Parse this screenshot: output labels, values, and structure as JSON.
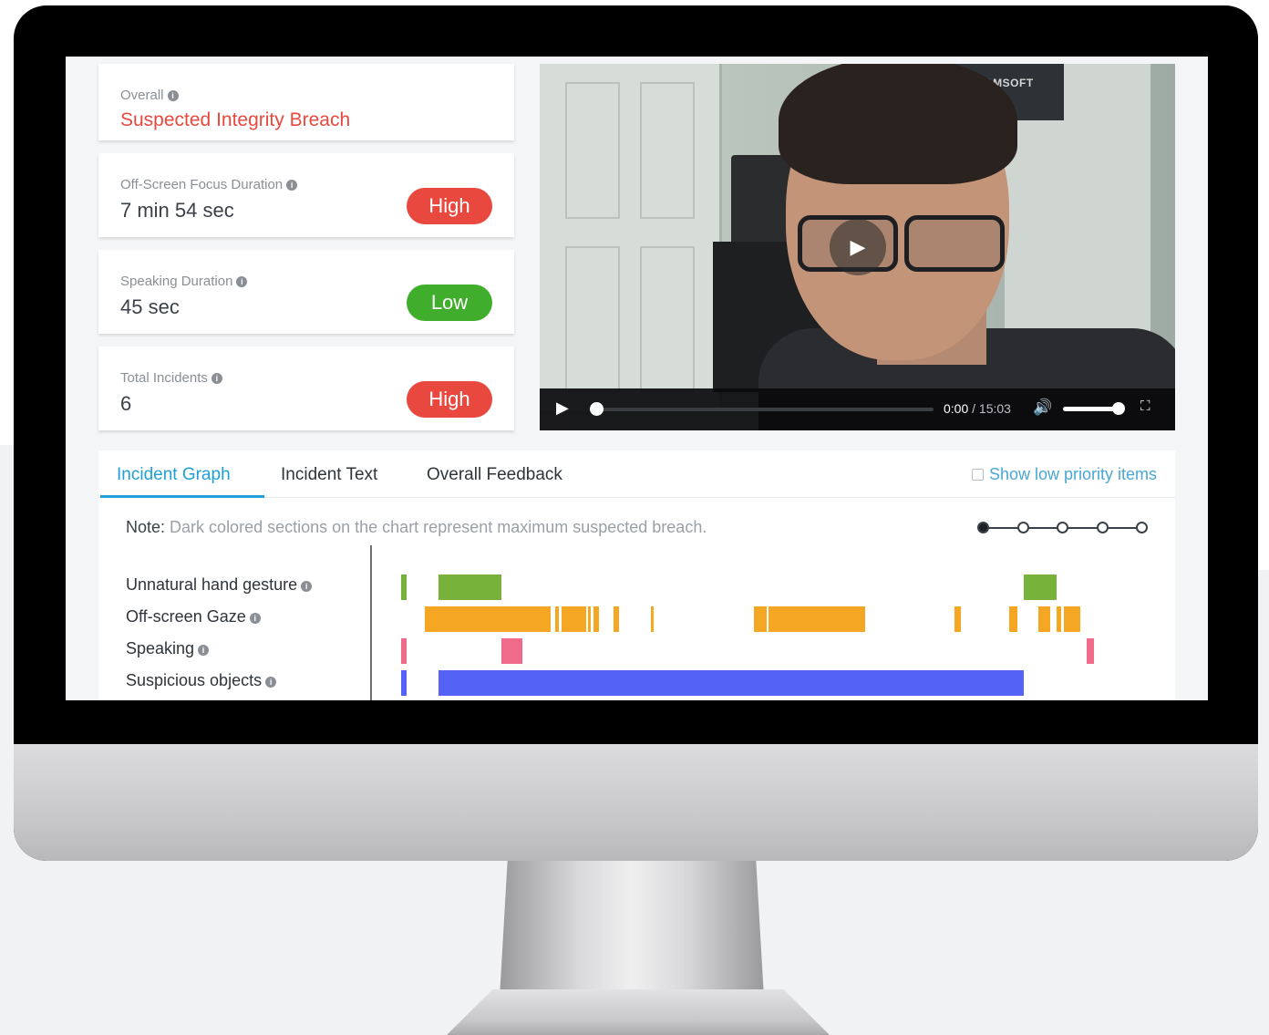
{
  "summary_cards": [
    {
      "label": "Overall",
      "value": "Suspected Integrity Breach",
      "badge": "",
      "value_color": "#e8483e"
    },
    {
      "label": "Off-Screen Focus Duration",
      "value": "7 min 54 sec",
      "badge": "High",
      "badge_color": "#e8483e"
    },
    {
      "label": "Speaking Duration",
      "value": "45 sec",
      "badge": "Low",
      "badge_color": "#40ad2c"
    },
    {
      "label": "Total Incidents",
      "value": "6",
      "badge": "High",
      "badge_color": "#e8483e"
    }
  ],
  "info_icon": "i",
  "video": {
    "poster_text": "EXAMSOFT",
    "current_time": "0:00",
    "separator": " / ",
    "duration": "15:03",
    "progress": 0.0,
    "volume": 1.0
  },
  "tabs": [
    {
      "label": "Incident Graph",
      "active": true
    },
    {
      "label": "Incident Text",
      "active": false
    },
    {
      "label": "Overall Feedback",
      "active": false
    }
  ],
  "low_priority_label": "Show low priority items",
  "note": {
    "prefix": "Note:",
    "text": "Dark colored sections on the chart represent maximum suspected breach."
  },
  "zoom_levels": 5,
  "zoom_selected": 0,
  "colors": {
    "accent": "#1ea0d6",
    "high": "#e8483e",
    "low": "#40ad2c",
    "gesture": "#77b33a",
    "gaze": "#f5a623",
    "speaking": "#f06b8a",
    "objects": "#5463f5"
  },
  "incident_rows": [
    {
      "label": "Unnatural hand gesture",
      "color_key": "gesture",
      "segments": [
        [
          0.0,
          0.8
        ],
        [
          5.4,
          14.5
        ],
        [
          89.9,
          94.6
        ]
      ]
    },
    {
      "label": "Off-screen Gaze",
      "color_key": "gaze",
      "segments": [
        [
          3.4,
          21.6
        ],
        [
          22.3,
          22.7
        ],
        [
          23.2,
          26.7
        ],
        [
          27.0,
          27.4
        ],
        [
          27.8,
          28.6
        ],
        [
          30.6,
          31.4
        ],
        [
          36.1,
          36.4
        ],
        [
          50.9,
          52.8
        ],
        [
          53.0,
          67.0
        ],
        [
          79.9,
          80.8
        ],
        [
          87.8,
          88.9
        ],
        [
          92.0,
          93.7
        ],
        [
          94.6,
          95.2
        ],
        [
          95.6,
          98.0
        ]
      ]
    },
    {
      "label": "Speaking",
      "color_key": "speaking",
      "segments": [
        [
          0.0,
          0.8
        ],
        [
          14.5,
          17.5
        ],
        [
          99.0,
          100.0
        ]
      ]
    },
    {
      "label": "Suspicious objects",
      "color_key": "objects",
      "segments": [
        [
          0.0,
          0.8
        ],
        [
          5.4,
          89.9
        ]
      ]
    }
  ]
}
